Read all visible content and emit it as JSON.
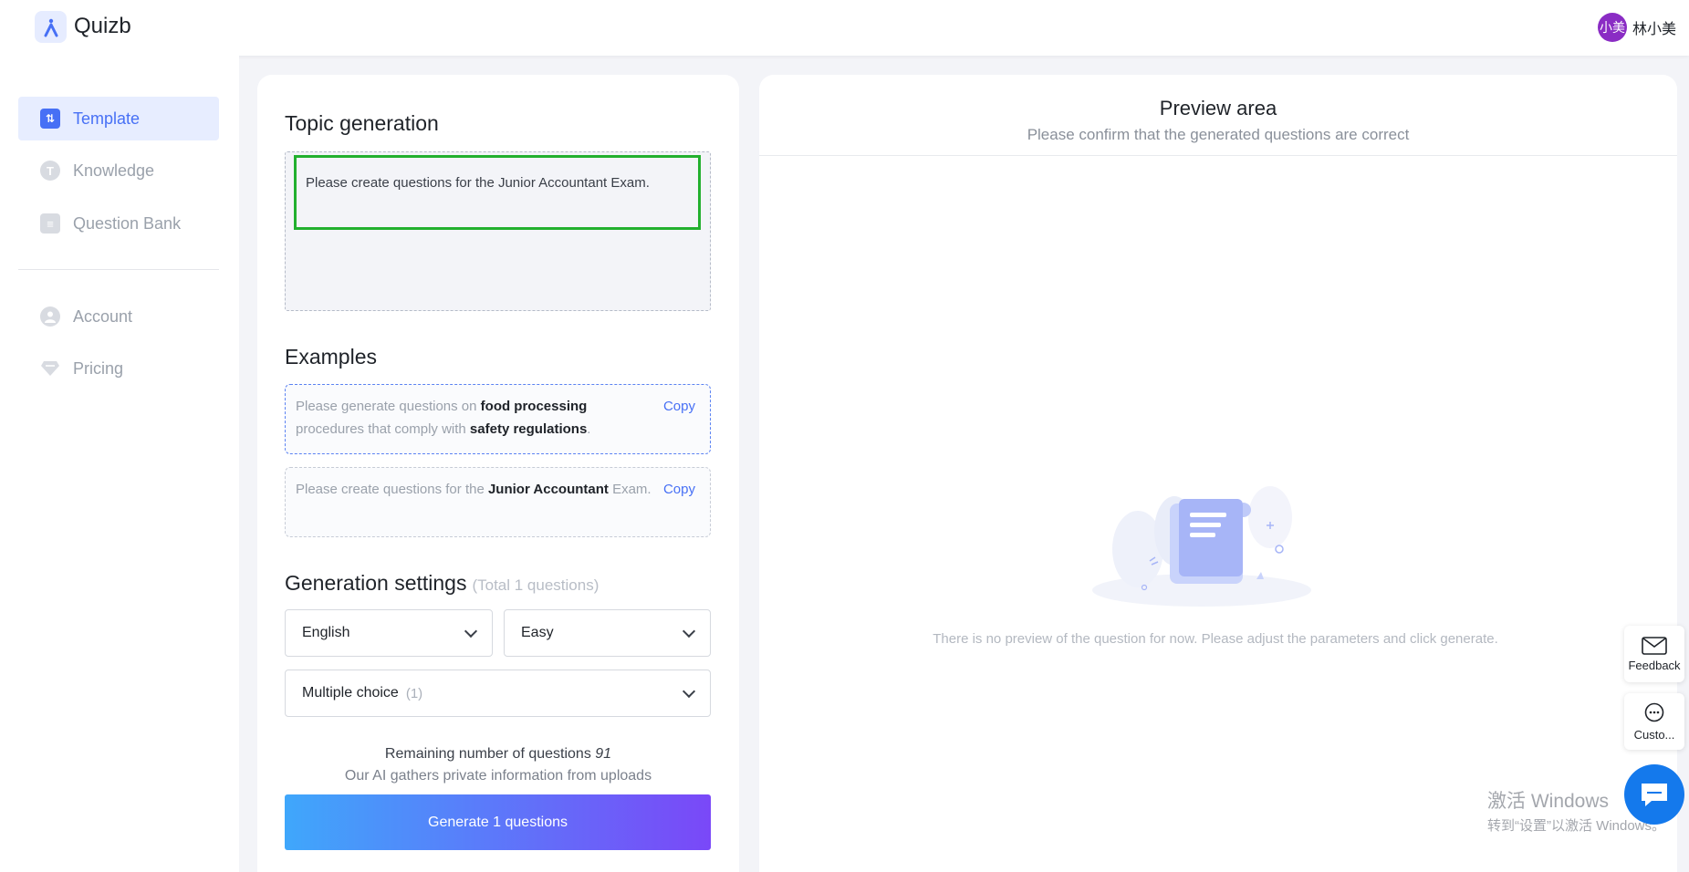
{
  "header": {
    "brand": "Quizb",
    "user_avatar_text": "小美",
    "user_name": "林小美"
  },
  "sidebar": {
    "items": [
      {
        "label": "Template",
        "icon": "template-icon",
        "active": true
      },
      {
        "label": "Knowledge",
        "icon": "knowledge-icon"
      },
      {
        "label": "Question Bank",
        "icon": "question-bank-icon"
      },
      {
        "label": "Account",
        "icon": "account-icon"
      },
      {
        "label": "Pricing",
        "icon": "pricing-icon"
      }
    ]
  },
  "topic": {
    "title": "Topic generation",
    "input_value": "Please create questions for the Junior Accountant Exam."
  },
  "examples": {
    "title": "Examples",
    "copy_label": "Copy",
    "items": [
      {
        "pre": "Please generate questions on ",
        "b1": "food processing",
        "mid": " procedures that comply with ",
        "b2": "safety regulations",
        "post": "."
      },
      {
        "pre": "Please create questions for the ",
        "b1": "Junior Accountant",
        "mid": " Exam.",
        "b2": "",
        "post": ""
      }
    ]
  },
  "settings": {
    "title": "Generation settings",
    "total": "(Total 1 questions)",
    "language": "English",
    "difficulty": "Easy",
    "question_type": "Multiple choice",
    "question_type_count": "(1)"
  },
  "remaining": {
    "label": "Remaining number of questions",
    "count": "91",
    "note": "Our AI gathers private information from uploads"
  },
  "generate_button": "Generate 1 questions",
  "preview": {
    "title": "Preview area",
    "subtitle": "Please confirm that the generated questions are correct",
    "empty": "There is no preview of the question for now. Please adjust the parameters and click generate."
  },
  "widgets": {
    "feedback": "Feedback",
    "customer": "Custo..."
  },
  "watermark": {
    "line1": "激活 Windows",
    "line2": "转到“设置”以激活 Windows。"
  }
}
